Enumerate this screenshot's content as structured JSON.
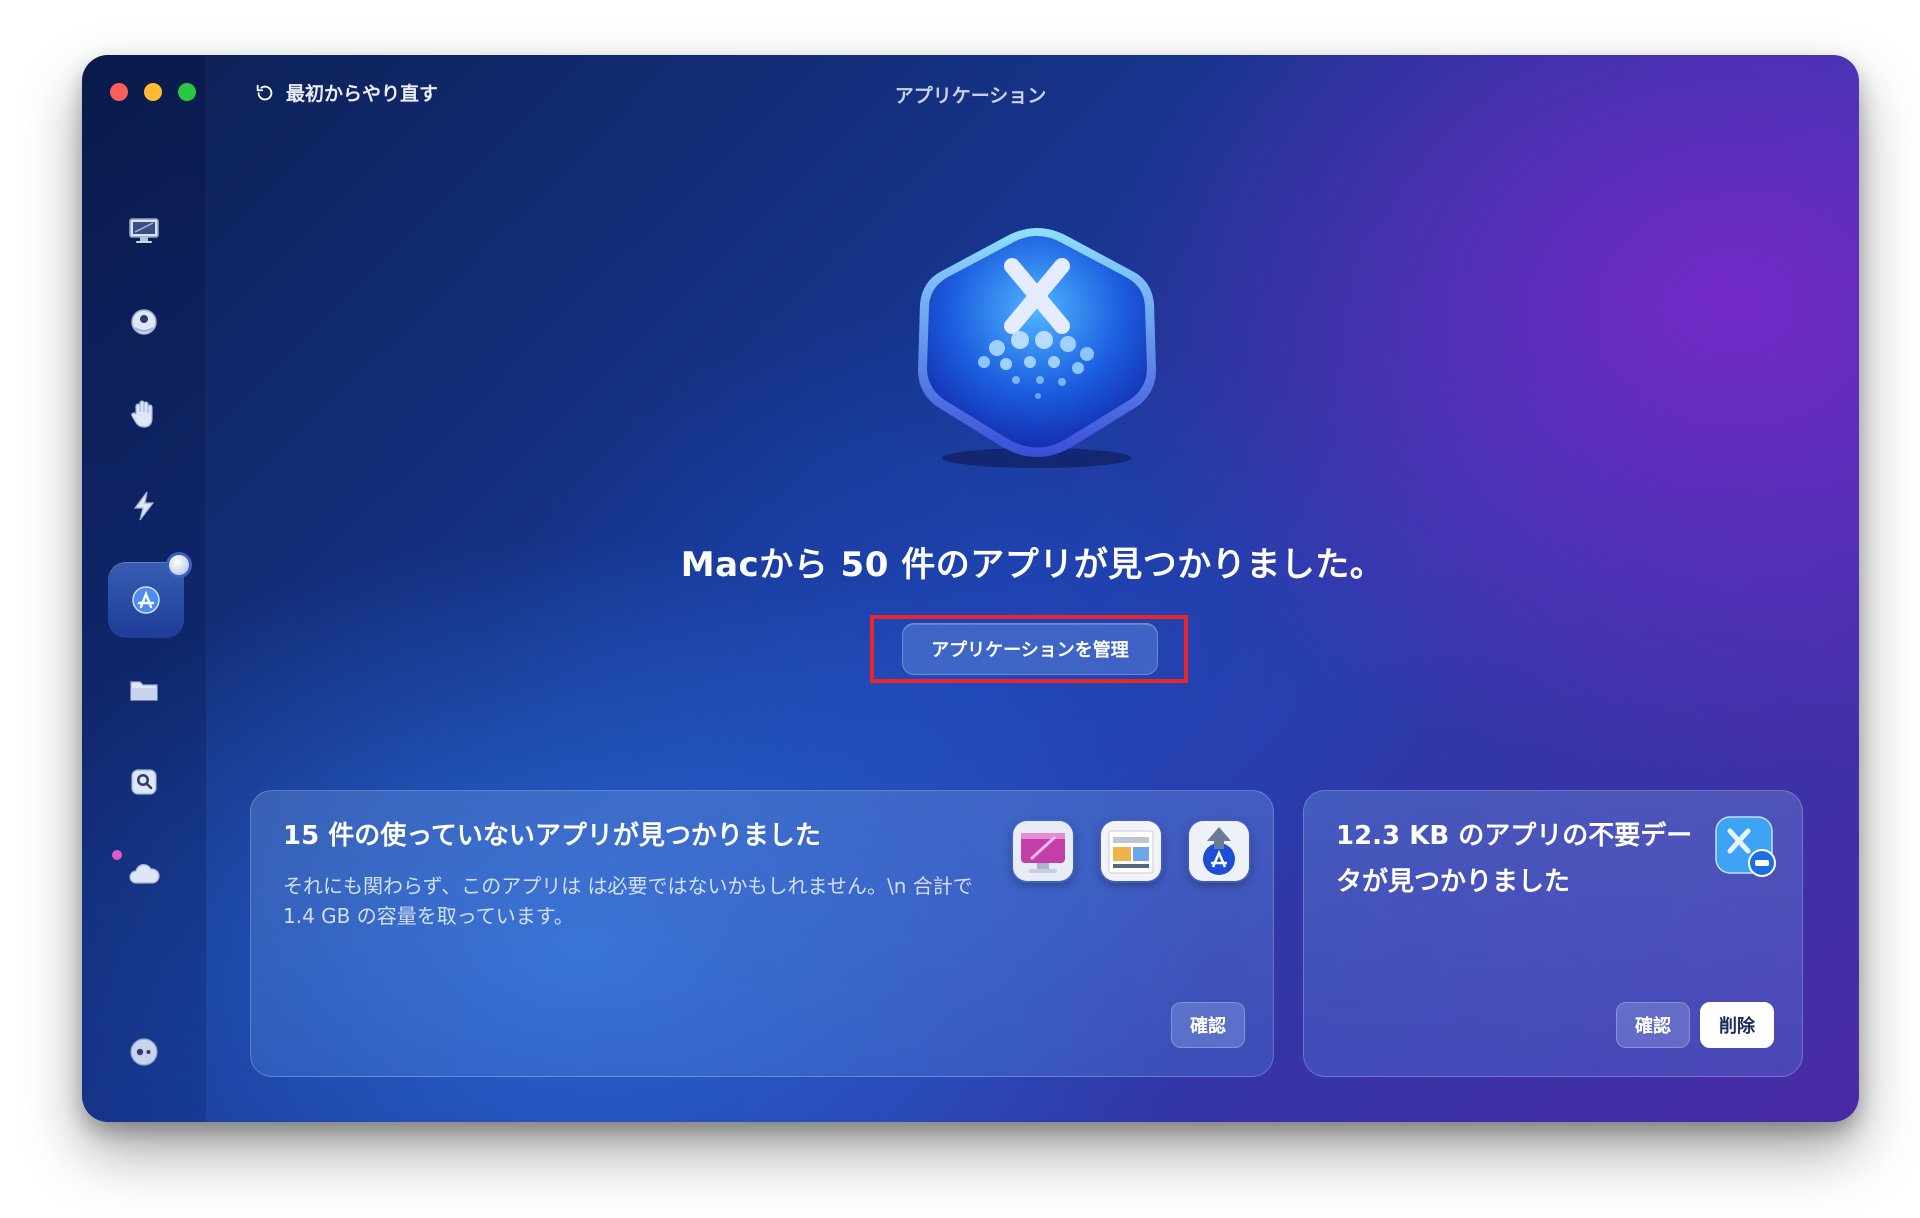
{
  "window": {
    "title": "アプリケーション",
    "restart_label": "最初からやり直す"
  },
  "sidebar": {
    "items": [
      {
        "name": "smart-scan",
        "icon": "monitor-icon"
      },
      {
        "name": "cleanup",
        "icon": "globe-icon"
      },
      {
        "name": "protection",
        "icon": "hand-icon"
      },
      {
        "name": "performance",
        "icon": "lightning-icon"
      },
      {
        "name": "applications",
        "icon": "app-store-icon",
        "active": true
      },
      {
        "name": "my-clutter",
        "icon": "folder-icon"
      },
      {
        "name": "space-lens",
        "icon": "magnifier-icon"
      },
      {
        "name": "cloud-cleanup",
        "icon": "cloud-icon"
      },
      {
        "name": "assistant",
        "icon": "assistant-icon"
      }
    ]
  },
  "main": {
    "headline": "Macから 50 件のアプリが見つかりました。",
    "manage_button": "アプリケーションを管理"
  },
  "cards": {
    "unused": {
      "title": "15 件の使っていないアプリが見つかりました",
      "description": "それにも関わらず、このアプリは は必要ではないかもしれません。\\n 合計で1.4 GB の容量を取っています。",
      "review_button": "確認",
      "app_icons": [
        "cleanmymac-icon",
        "preview-app-icon",
        "app-installer-icon"
      ]
    },
    "leftovers": {
      "title": "12.3 KB のアプリの不要データが見つかりました",
      "review_button": "確認",
      "remove_button": "削除",
      "icon": "app-leftovers-icon"
    }
  },
  "colors": {
    "close": "#ff5f57",
    "minimize": "#febc2e",
    "zoom": "#28c840",
    "highlight": "#e8262b"
  }
}
